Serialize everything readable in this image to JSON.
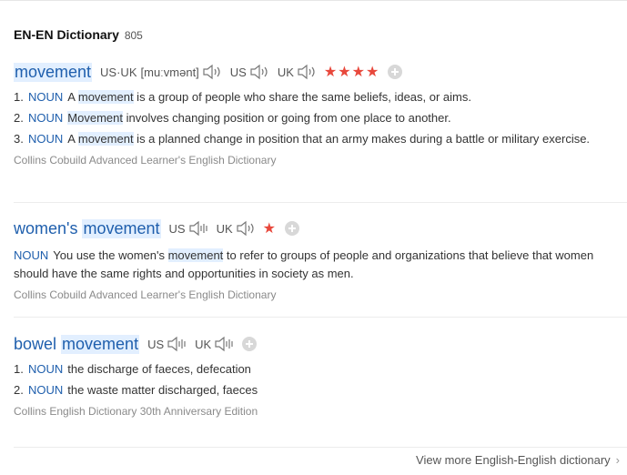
{
  "dictionary": {
    "title": "EN-EN Dictionary",
    "count": "805"
  },
  "entries": [
    {
      "headword": "movement",
      "pron_label": "US·UK",
      "ipa": "[muːvmənt]",
      "us_label": "US",
      "uk_label": "UK",
      "stars": "★★★★",
      "definitions": [
        {
          "num": "1.",
          "pos": "NOUN",
          "before": "A ",
          "mark": "movement",
          "after": " is a group of people who share the same beliefs, ideas, or aims."
        },
        {
          "num": "2.",
          "pos": "NOUN",
          "before": "",
          "mark": "Movement",
          "after": " involves changing position or going from one place to another."
        },
        {
          "num": "3.",
          "pos": "NOUN",
          "before": "A ",
          "mark": "movement",
          "after": " is a planned change in position that an army makes during a battle or military exercise."
        }
      ],
      "source": "Collins Cobuild Advanced Learner's English Dictionary"
    },
    {
      "headword_prefix": "women's",
      "headword_mark": "movement",
      "us_label": "US",
      "uk_label": "UK",
      "stars": "★",
      "pos": "NOUN",
      "before": "You use the women's ",
      "mark": "movement",
      "after": " to refer to groups of people and organizations that believe that women should have the same rights and opportunities in society as men.",
      "source": "Collins Cobuild Advanced Learner's English Dictionary"
    },
    {
      "headword_prefix": "bowel",
      "headword_mark": "movement",
      "us_label": "US",
      "uk_label": "UK",
      "definitions": [
        {
          "num": "1.",
          "pos": "NOUN",
          "text": "the discharge of faeces, defecation"
        },
        {
          "num": "2.",
          "pos": "NOUN",
          "text": "the waste matter discharged, faeces"
        }
      ],
      "source": "Collins English Dictionary 30th Anniversary Edition"
    }
  ],
  "footer": {
    "more_label": "View more English-English dictionary",
    "chevron": "›"
  },
  "icons": {
    "speaker": "speaker-icon",
    "add": "add-circle-icon",
    "chevron": "chevron-right-icon"
  },
  "colors": {
    "headword": "#1f5fad",
    "highlight": "#e2efff",
    "star": "#e8483c"
  }
}
